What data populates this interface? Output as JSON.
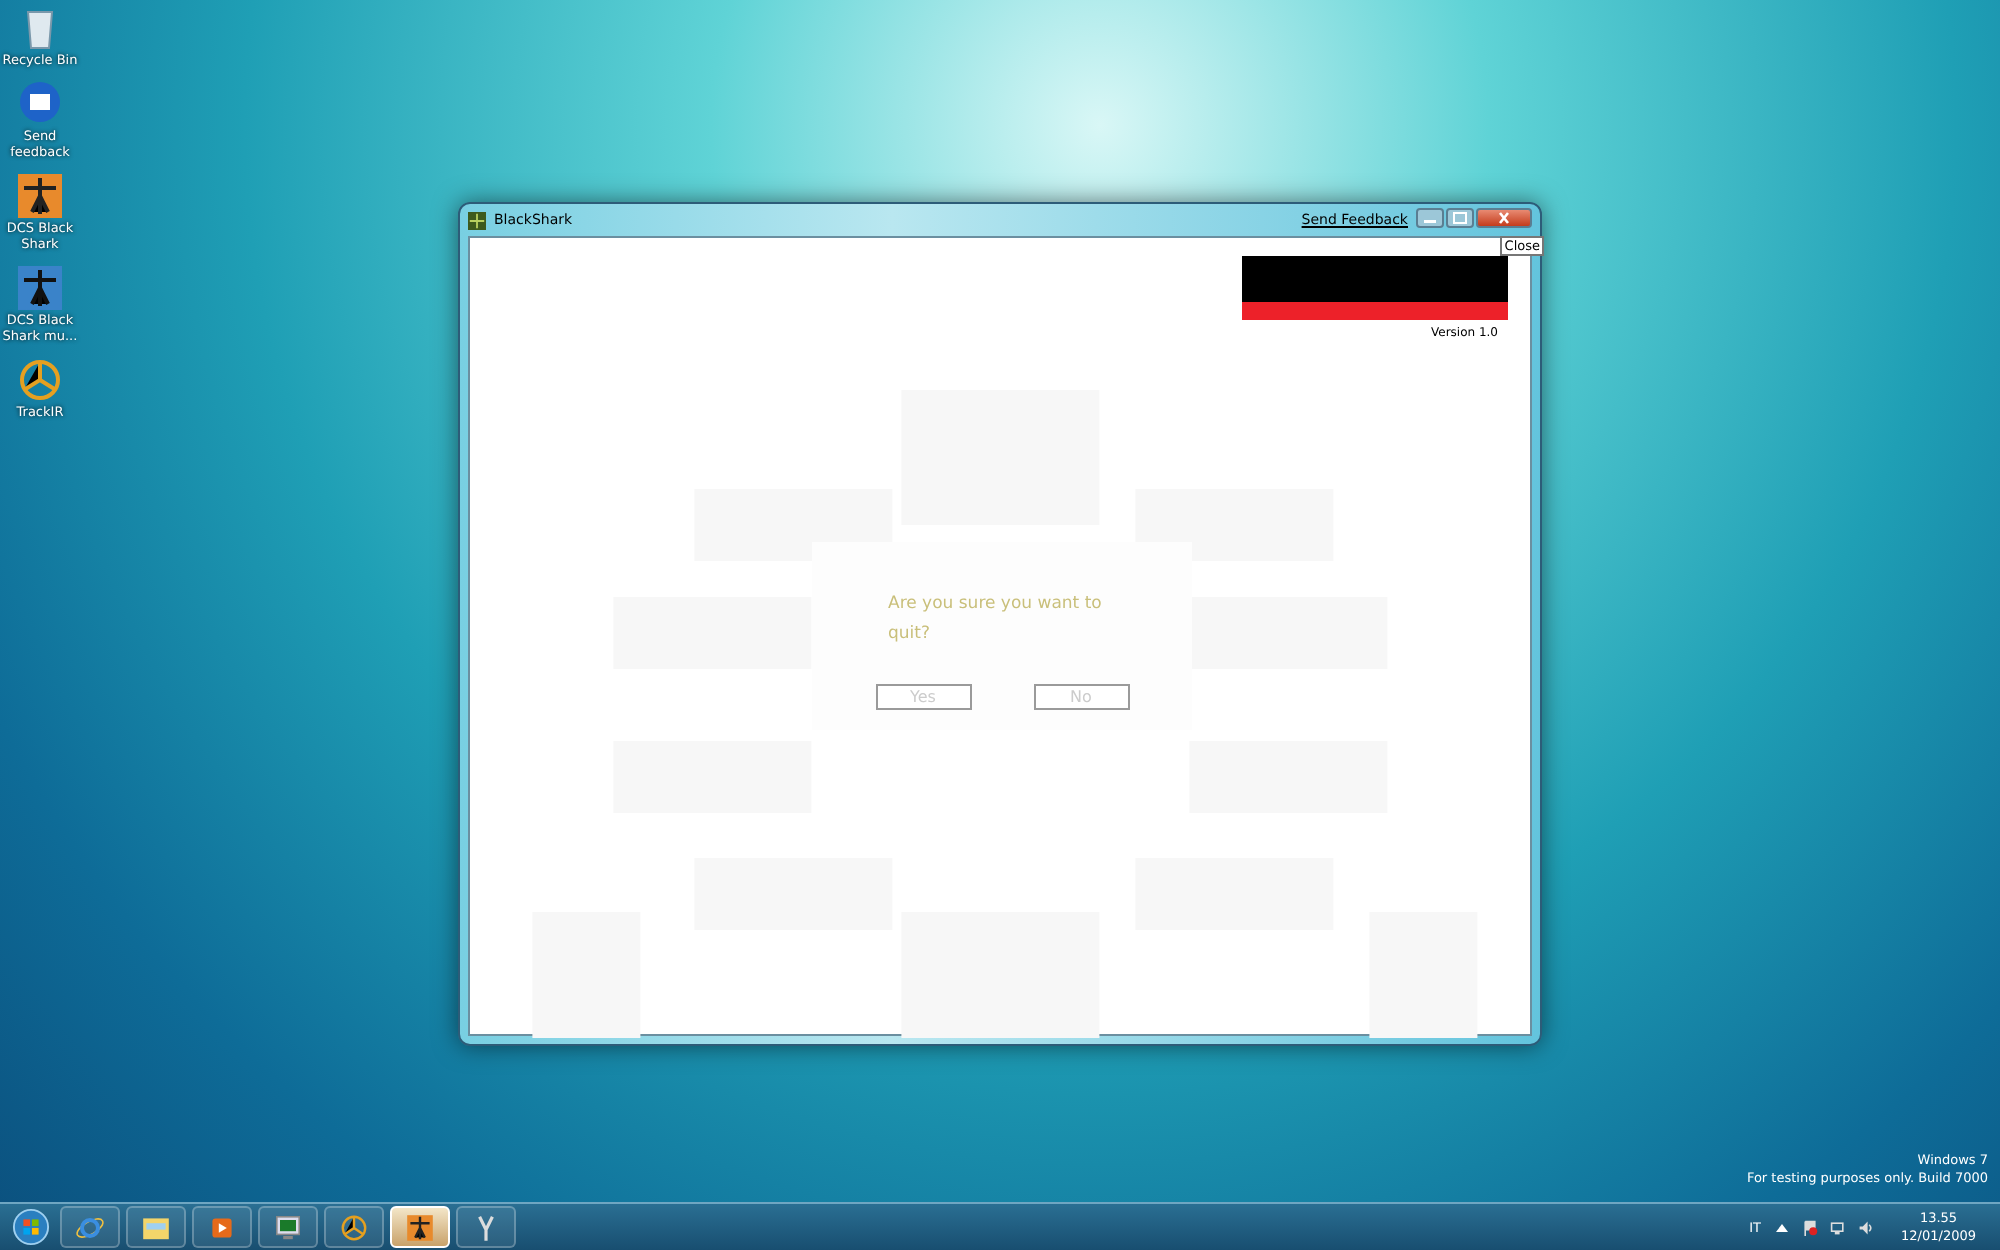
{
  "desktop_icons": [
    {
      "kind": "recycle",
      "label": "Recycle Bin"
    },
    {
      "kind": "feedback",
      "label": "Send feedback"
    },
    {
      "kind": "shark",
      "label": "DCS Black Shark"
    },
    {
      "kind": "shark-blue",
      "label": "DCS Black Shark mu..."
    },
    {
      "kind": "trackir",
      "label": "TrackIR"
    }
  ],
  "window": {
    "title": "BlackShark",
    "feedback_link": "Send Feedback",
    "tooltip": "Close",
    "version": "Version 1.0",
    "dialog": {
      "message": "Are you sure you want to quit?",
      "buttons": [
        "Yes",
        "No"
      ]
    }
  },
  "watermark_os": {
    "line_1": "Windows 7",
    "line_2": "For testing purposes only. Build 7000"
  },
  "taskbar": {
    "items": [
      {
        "kind": "ie",
        "active": false
      },
      {
        "kind": "explorer",
        "active": false
      },
      {
        "kind": "media",
        "active": false
      },
      {
        "kind": "monitor",
        "active": false
      },
      {
        "kind": "trackir",
        "active": false
      },
      {
        "kind": "shark",
        "active": true
      },
      {
        "kind": "tool",
        "active": false
      }
    ],
    "language": "IT",
    "time": "13.55",
    "date": "12/01/2009"
  }
}
